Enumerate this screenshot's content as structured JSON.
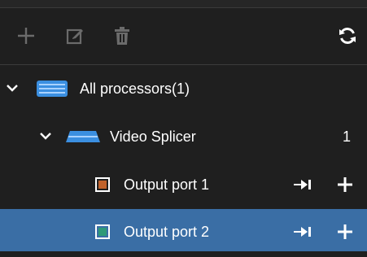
{
  "toolbar": {
    "add_icon": "plus-icon",
    "edit_icon": "edit-icon",
    "delete_icon": "trash-icon",
    "refresh_icon": "refresh-icon",
    "disabled_color": "#6b6b6b",
    "active_color": "#ffffff"
  },
  "tree": {
    "root": {
      "label": "All processors(1)",
      "expanded": true,
      "icon": "processor-icon"
    },
    "device": {
      "label": "Video Splicer",
      "count": "1",
      "expanded": true,
      "icon": "video-splicer-icon"
    },
    "ports": [
      {
        "label": "Output port 1",
        "color": "#c0622b",
        "selected": false,
        "actions": [
          "pin-icon",
          "plus-icon"
        ]
      },
      {
        "label": "Output port 2",
        "color": "#2e9a78",
        "selected": true,
        "actions": [
          "pin-icon",
          "plus-icon"
        ]
      }
    ]
  },
  "colors": {
    "background": "#1f1f1f",
    "selection": "#3a6ea5",
    "device_blue": "#3b8fe0"
  }
}
